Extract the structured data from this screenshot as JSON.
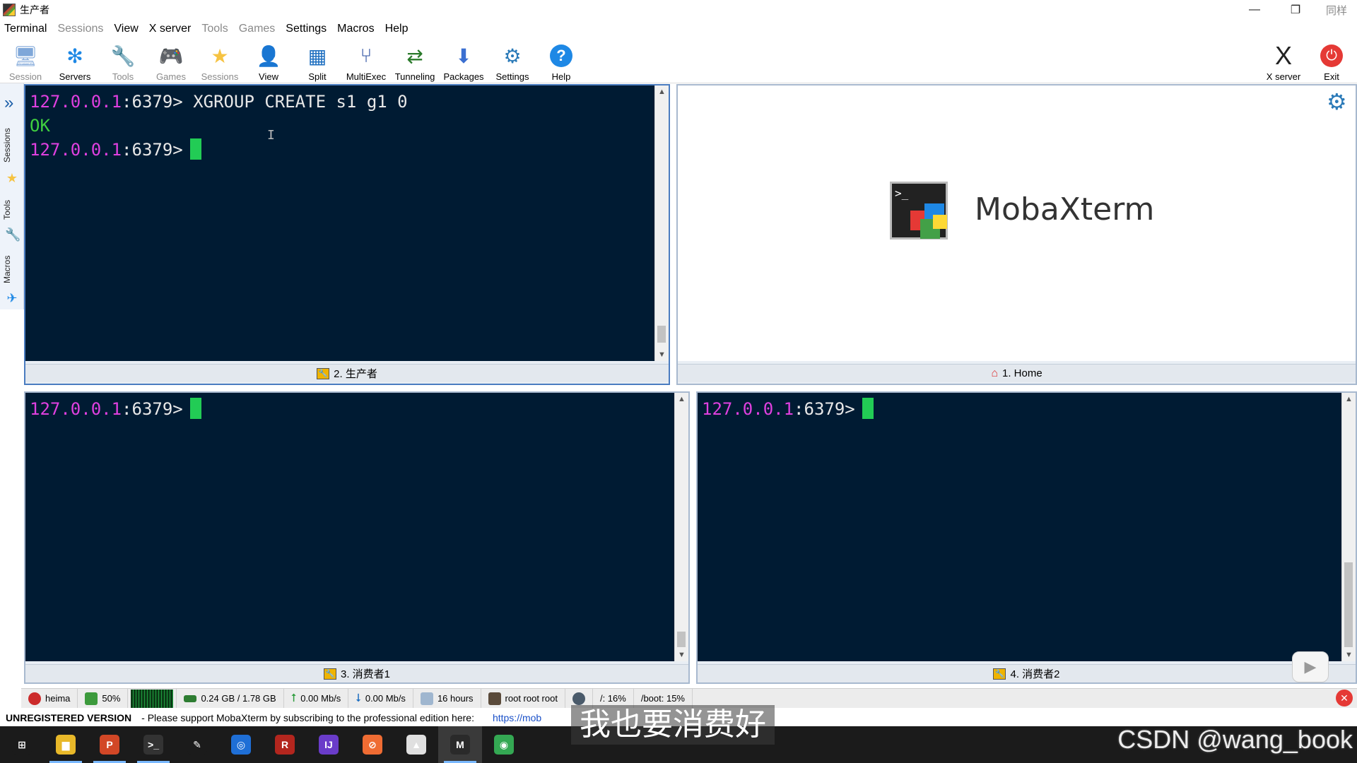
{
  "window": {
    "title": "生产者",
    "corner_text": "同样"
  },
  "menu": [
    {
      "label": "Terminal",
      "dim": false
    },
    {
      "label": "Sessions",
      "dim": true
    },
    {
      "label": "View",
      "dim": false
    },
    {
      "label": "X server",
      "dim": false
    },
    {
      "label": "Tools",
      "dim": true
    },
    {
      "label": "Games",
      "dim": true
    },
    {
      "label": "Settings",
      "dim": false
    },
    {
      "label": "Macros",
      "dim": false
    },
    {
      "label": "Help",
      "dim": false
    }
  ],
  "toolbar": {
    "session": "Session",
    "servers": "Servers",
    "tools": "Tools",
    "games": "Games",
    "sessions": "Sessions",
    "view": "View",
    "split": "Split",
    "multiexec": "MultiExec",
    "tunneling": "Tunneling",
    "packages": "Packages",
    "settings": "Settings",
    "help": "Help",
    "xserver": "X server",
    "exit": "Exit"
  },
  "sidebar": {
    "sessions": "Sessions",
    "tools": "Tools",
    "macros": "Macros"
  },
  "panes": {
    "top_left": {
      "tab": "2. 生产者",
      "line1_host": "127.0.0.1",
      "line1_rest": ":6379> XGROUP CREATE s1 g1 0",
      "line2": "OK",
      "line3_host": "127.0.0.1",
      "line3_rest": ":6379>"
    },
    "top_right": {
      "tab": "1. Home",
      "brand": "MobaXterm",
      "logo_prompt": ">_"
    },
    "bottom_left": {
      "tab": "3. 消费者1",
      "line1_host": "127.0.0.1",
      "line1_rest": ":6379>"
    },
    "bottom_right": {
      "tab": "4. 消费者2",
      "line1_host": "127.0.0.1",
      "line1_rest": ":6379>"
    }
  },
  "statusbar": {
    "host": "heima",
    "cpu": "50%",
    "memory": "0.24 GB / 1.78 GB",
    "upload": "0.00 Mb/s",
    "download": "0.00 Mb/s",
    "uptime": "16 hours",
    "users": "root  root  root",
    "disk_root": "/: 16%",
    "disk_boot": "/boot: 15%"
  },
  "notice": {
    "unregistered": "UNREGISTERED VERSION",
    "message": "-  Please support MobaXterm by subscribing to the professional edition here:",
    "link": "https://mob"
  },
  "overlay": {
    "subtitle": "我也要消费好",
    "watermark": "CSDN @wang_book"
  },
  "taskbar": [
    {
      "name": "windows-start",
      "color": "#1b1b1b",
      "glyph": "⊞"
    },
    {
      "name": "file-explorer",
      "color": "#e8b829",
      "glyph": "▆"
    },
    {
      "name": "powerpoint",
      "color": "#d24726",
      "glyph": "P"
    },
    {
      "name": "terminal",
      "color": "#333333",
      "glyph": ">_"
    },
    {
      "name": "pen-tool",
      "color": "#1b1b1b",
      "glyph": "✎"
    },
    {
      "name": "browser-blue",
      "color": "#1f6fd6",
      "glyph": "◎"
    },
    {
      "name": "redis-desktop",
      "color": "#b3261e",
      "glyph": "R"
    },
    {
      "name": "intellij",
      "color": "#6a3cc9",
      "glyph": "IJ"
    },
    {
      "name": "postman",
      "color": "#ef6c33",
      "glyph": "⊘"
    },
    {
      "name": "typora",
      "color": "#e0e0e0",
      "glyph": "▲"
    },
    {
      "name": "mobaxterm",
      "color": "#2a2a2a",
      "glyph": "M"
    },
    {
      "name": "chrome",
      "color": "#34a853",
      "glyph": "◉"
    }
  ],
  "colors": {
    "terminal_bg": "#001b33",
    "prompt_host": "#e040e0",
    "cursor": "#22cc55",
    "ok": "#40d040"
  }
}
